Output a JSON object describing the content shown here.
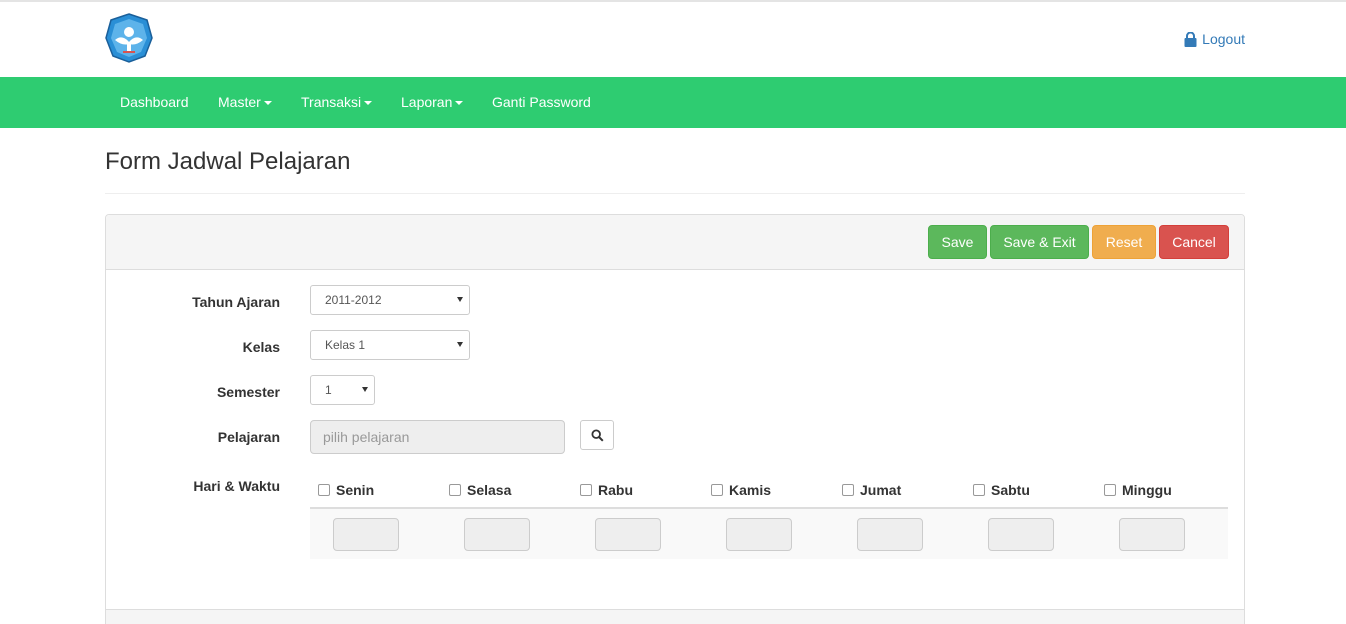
{
  "header": {
    "logo_icon": "tut-wuri-handayani-logo",
    "logout_label": "Logout"
  },
  "nav": {
    "items": [
      {
        "label": "Dashboard",
        "dropdown": false
      },
      {
        "label": "Master",
        "dropdown": true
      },
      {
        "label": "Transaksi",
        "dropdown": true
      },
      {
        "label": "Laporan",
        "dropdown": true
      },
      {
        "label": "Ganti Password",
        "dropdown": false
      }
    ],
    "bg_color": "#2ecc71"
  },
  "page": {
    "title": "Form Jadwal Pelajaran"
  },
  "toolbar": {
    "save": "Save",
    "save_exit": "Save & Exit",
    "reset": "Reset",
    "cancel": "Cancel"
  },
  "form": {
    "tahun_ajaran": {
      "label": "Tahun Ajaran",
      "value": "2011-2012"
    },
    "kelas": {
      "label": "Kelas",
      "value": "Kelas 1"
    },
    "semester": {
      "label": "Semester",
      "value": "1"
    },
    "pelajaran": {
      "label": "Pelajaran",
      "placeholder": "pilih pelajaran"
    },
    "hari_waktu": {
      "label": "Hari & Waktu",
      "days": [
        "Senin",
        "Selasa",
        "Rabu",
        "Kamis",
        "Jumat",
        "Sabtu",
        "Minggu"
      ]
    }
  }
}
